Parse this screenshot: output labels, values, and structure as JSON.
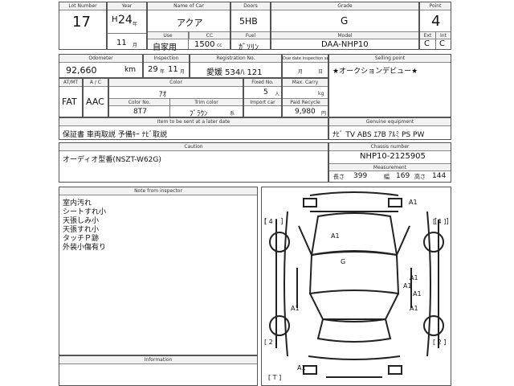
{
  "header": {
    "lot_label": "Lot Number",
    "lot": "17",
    "year_label": "Year",
    "era": "H",
    "year": "24",
    "year_unit": "年",
    "month": "11",
    "month_unit": "月",
    "name_label": "Name of Car",
    "name": "アクア",
    "doors_label": "Doors",
    "doors": "5HB",
    "grade_label": "Grade",
    "grade": "G",
    "point_label": "Point",
    "point": "4",
    "use_label": "Use",
    "use": "自家用",
    "cc_label": "CC",
    "cc": "1500",
    "cc_unit": "cc",
    "fuel_label": "Fuel",
    "fuel": "ｶﾞｿﾘﾝ",
    "model_label": "Model",
    "model": "DAA-NHP10",
    "ext_label": "Ext",
    "ext": "C",
    "int_label": "Int",
    "int": "C"
  },
  "row2": {
    "odometer_label": "Odometer",
    "odometer": "92,660",
    "odometer_unit": "km",
    "inspection_label": "Inspection",
    "insp_year": "29",
    "insp_year_unit": "年",
    "insp_month": "11",
    "insp_month_unit": "月",
    "reg_label": "Registration No.",
    "reg": "愛媛 534ﾊ 121",
    "due_label": "Due date inspection service",
    "due_month_unit": "月",
    "due_day_unit": "日",
    "selling_label": "Selling point",
    "selling": "★オークションデビュー★"
  },
  "row3": {
    "atmt_label": "AT/MT",
    "atmt": "FAT",
    "ac_label": "A / C",
    "ac": "AAC",
    "color_label": "Color",
    "color": "ｱｵ",
    "fixed_label": "Fixed No.",
    "fixed": "5",
    "fixed_unit": "人",
    "carry_label": "Max. Carry",
    "carry_unit": "kg",
    "colorno_label": "Color No.",
    "colorno": "8T7",
    "trim_label": "Trim color",
    "trim": "ﾌﾞﾗｳﾝ",
    "trim_unit": "系",
    "import_label": "Import car",
    "recycle_label": "Paid Recycle",
    "recycle": "9,980",
    "recycle_unit": "円"
  },
  "items": {
    "label": "Item to be sent at a later date",
    "value": "保証書 車両取説 予備ｷｰ ﾅﾋﾞ取説"
  },
  "equipment": {
    "label": "Genuine equipment",
    "value": "ﾅﾋﾞ TV ABS ｴｱB ｱﾙﾐ PS PW"
  },
  "caution": {
    "label": "Caution",
    "value": "オーディオ型番(NSZT-W62G)"
  },
  "chassis": {
    "label": "Chassis number",
    "value": "NHP10-2125905"
  },
  "measurement": {
    "label": "Measurement",
    "length_label": "長さ",
    "length": "399",
    "width_label": "幅",
    "width": "169",
    "height_label": "高さ",
    "height": "144"
  },
  "inspector": {
    "label": "Note from inspector",
    "notes": [
      "室内汚れ",
      "シートすれ小",
      "天張しみ小",
      "天張すれ小",
      "タッチＰ跡",
      "外装小傷有り"
    ]
  },
  "information": {
    "label": "Information"
  },
  "diagram": {
    "marks": {
      "a1_front_right": "A1",
      "a1_hood": "A1",
      "g_roof": "G",
      "a1_right_1": "A1",
      "a1_right_2": "A1",
      "a1_right_3": "A1",
      "a1_left_rear": "A1",
      "a1_rear_right": "A1",
      "a1_bottom": "A1",
      "tire_fl": "[ 4 ]",
      "tire_fr": "[ 4 ]",
      "tire_rl": "[ 2 ]",
      "tire_rr": "[ 2 ]",
      "spare": "[ T ]"
    }
  }
}
